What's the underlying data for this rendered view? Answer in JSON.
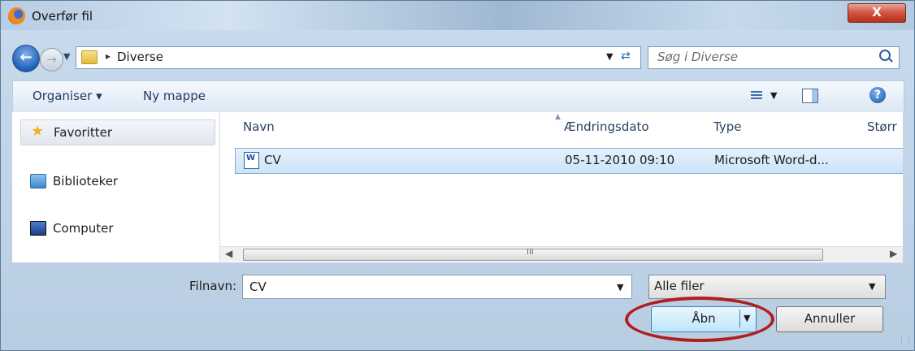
{
  "window": {
    "title": "Overfør fil",
    "close_glyph": "X"
  },
  "address": {
    "crumb": "Diverse",
    "search_placeholder": "Søg i Diverse"
  },
  "toolbar": {
    "organize": "Organiser ▾",
    "new_folder": "Ny mappe",
    "help_glyph": "?"
  },
  "nav": {
    "items": [
      {
        "label": "Favoritter"
      },
      {
        "label": "Biblioteker"
      },
      {
        "label": "Computer"
      }
    ]
  },
  "columns": [
    "Navn",
    "Ændringsdato",
    "Type",
    "Størr"
  ],
  "files": [
    {
      "name": "CV",
      "date": "05-11-2010 09:10",
      "type": "Microsoft Word-d..."
    }
  ],
  "scrollbar": {
    "grip": "III"
  },
  "filename": {
    "label": "Filnavn:",
    "value": "CV"
  },
  "filter": {
    "selected": "Alle filer"
  },
  "buttons": {
    "open": "Åbn",
    "cancel": "Annuller"
  },
  "colors": {
    "highlight": "#b01e1e",
    "selection": "#cde3f8"
  }
}
